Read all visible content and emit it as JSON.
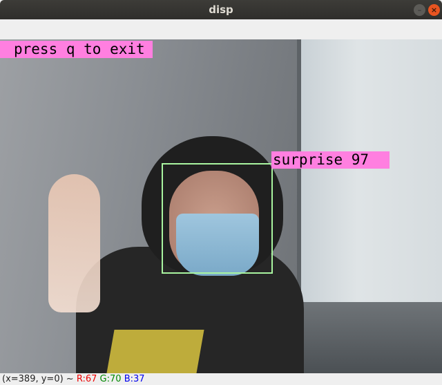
{
  "window": {
    "title": "disp"
  },
  "overlay": {
    "exit_label": "press q to exit",
    "emotion_label": "surprise 97",
    "box_color": "#a9f5a0",
    "label_color": "#ff7fe0"
  },
  "status": {
    "coords": "(x=389, y=0) ~",
    "r": "R:67",
    "g": "G:70",
    "b": "B:37"
  }
}
